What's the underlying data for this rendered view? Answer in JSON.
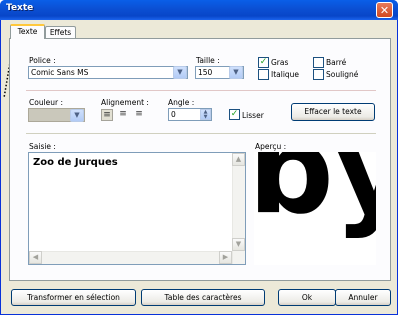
{
  "window": {
    "title": "Texte",
    "close_glyph": "✕"
  },
  "tabs": [
    {
      "label": "Texte",
      "active": true
    },
    {
      "label": "Effets",
      "active": false
    }
  ],
  "font": {
    "label": "Police :",
    "value": "Comic Sans MS"
  },
  "size": {
    "label": "Taille :",
    "value": "150"
  },
  "styles": {
    "bold": {
      "label": "Gras",
      "checked": true
    },
    "italic": {
      "label": "Italique",
      "checked": false
    },
    "strike": {
      "label": "Barré",
      "checked": false
    },
    "underline": {
      "label": "Souligné",
      "checked": false
    }
  },
  "color": {
    "label": "Couleur :"
  },
  "alignment": {
    "label": "Alignement :"
  },
  "angle": {
    "label": "Angle :",
    "value": "0"
  },
  "smooth": {
    "label": "Lisser",
    "checked": true
  },
  "clear_button": "Effacer le texte",
  "input": {
    "label": "Saisie :",
    "value": "Zoo de Jurques"
  },
  "preview": {
    "label": "Aperçu :",
    "text": "by"
  },
  "buttons": {
    "transform": "Transformer en sélection",
    "charmap": "Table des caractères",
    "ok": "Ok",
    "cancel": "Annuler"
  },
  "icons": {
    "dropdown": "chevron-down-icon",
    "check": "check-icon",
    "close": "close-icon"
  }
}
